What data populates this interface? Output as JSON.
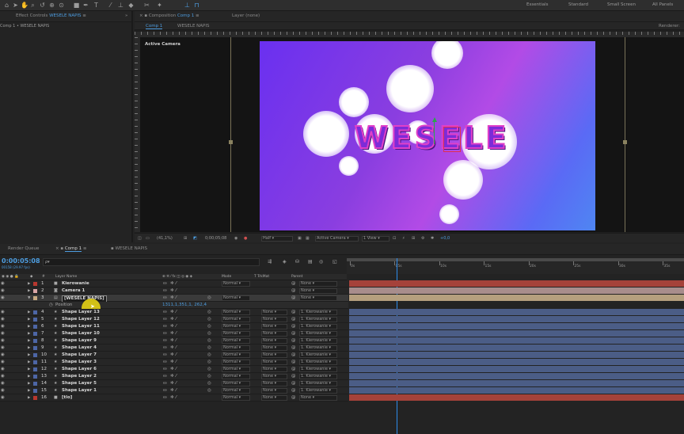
{
  "workspaces": [
    "Essentials",
    "Standard",
    "Small Screen",
    "All Panels"
  ],
  "left_panel": {
    "tab_label": "Effect Controls",
    "tab_layer": "WESELE NAPIS",
    "breadcrumb": "Comp 1 • WESELE NAPIS"
  },
  "comp_panel": {
    "tab_label": "Composition",
    "tab_comp": "Comp 1",
    "layer_tab": "Layer (none)",
    "nav_comp": "Comp 1",
    "nav_layer": "WESELE NAPIS",
    "renderer": "Renderer:",
    "active_camera": "Active Camera",
    "canvas_text": "WESELE",
    "zoom": "(41,1%)",
    "timecode": "0;00;05;08",
    "resolution": "Half",
    "view": "Active Camera",
    "views": "1 View",
    "exposure": "+0,0"
  },
  "bottom_tabs": {
    "render_queue": "Render Queue",
    "comp": "Comp 1",
    "layer": "WESELE NAPIS"
  },
  "timeline": {
    "current_time": "0:00:05:08",
    "frame_info": "00158 (29.97 fps)",
    "search_placeholder": "ρ▾",
    "columns": {
      "layer_name": "Layer Name",
      "mode": "Mode",
      "trkmat": "T TrkMat",
      "parent": "Parent"
    },
    "ruler_ticks": [
      "0s",
      "05s",
      "10s",
      "15s",
      "20s",
      "25s",
      "30s",
      "35s"
    ],
    "playhead_fraction": 0.149,
    "layers": [
      {
        "num": "1",
        "name": "Kierowanie",
        "color": "#b8372f",
        "icon": "null-box",
        "mode": "Normal",
        "trkmat": "",
        "parent": "None",
        "bar": "#a5423a"
      },
      {
        "num": "2",
        "name": "Camera 1",
        "color": "#d9a6a6",
        "icon": "camera-icon",
        "mode": "",
        "trkmat": "",
        "parent": "None",
        "bar": "#a88d8c"
      },
      {
        "num": "3",
        "name": "[WESELE NAPIS]",
        "color": "#c7a982",
        "icon": "precomp-icon",
        "mode": "Normal",
        "trkmat": "",
        "parent": "None",
        "bar": "#b59f7e"
      },
      {
        "num": "4",
        "name": "Shape Layer 13",
        "color": "#4d66a6",
        "icon": "star-icon",
        "mode": "Normal",
        "trkmat": "None",
        "parent": "1. Kierowanie",
        "bar": "#4b5d86"
      },
      {
        "num": "5",
        "name": "Shape Layer 12",
        "color": "#4d66a6",
        "icon": "star-icon",
        "mode": "Normal",
        "trkmat": "None",
        "parent": "1. Kierowanie",
        "bar": "#4b5d86"
      },
      {
        "num": "6",
        "name": "Shape Layer 11",
        "color": "#4d66a6",
        "icon": "star-icon",
        "mode": "Normal",
        "trkmat": "None",
        "parent": "1. Kierowanie",
        "bar": "#4b5d86"
      },
      {
        "num": "7",
        "name": "Shape Layer 10",
        "color": "#4d66a6",
        "icon": "star-icon",
        "mode": "Normal",
        "trkmat": "None",
        "parent": "1. Kierowanie",
        "bar": "#4b5d86"
      },
      {
        "num": "8",
        "name": "Shape Layer 9",
        "color": "#4d66a6",
        "icon": "star-icon",
        "mode": "Normal",
        "trkmat": "None",
        "parent": "1. Kierowanie",
        "bar": "#4b5d86"
      },
      {
        "num": "9",
        "name": "Shape Layer 4",
        "color": "#4d66a6",
        "icon": "star-icon",
        "mode": "Normal",
        "trkmat": "None",
        "parent": "1. Kierowanie",
        "bar": "#4b5d86"
      },
      {
        "num": "10",
        "name": "Shape Layer 7",
        "color": "#4d66a6",
        "icon": "star-icon",
        "mode": "Normal",
        "trkmat": "None",
        "parent": "1. Kierowanie",
        "bar": "#4b5d86"
      },
      {
        "num": "11",
        "name": "Shape Layer 3",
        "color": "#4d66a6",
        "icon": "star-icon",
        "mode": "Normal",
        "trkmat": "None",
        "parent": "1. Kierowanie",
        "bar": "#4b5d86"
      },
      {
        "num": "12",
        "name": "Shape Layer 6",
        "color": "#4d66a6",
        "icon": "star-icon",
        "mode": "Normal",
        "trkmat": "None",
        "parent": "1. Kierowanie",
        "bar": "#4b5d86"
      },
      {
        "num": "13",
        "name": "Shape Layer 2",
        "color": "#4d66a6",
        "icon": "star-icon",
        "mode": "Normal",
        "trkmat": "None",
        "parent": "1. Kierowanie",
        "bar": "#4b5d86"
      },
      {
        "num": "14",
        "name": "Shape Layer 5",
        "color": "#4d66a6",
        "icon": "star-icon",
        "mode": "Normal",
        "trkmat": "None",
        "parent": "1. Kierowanie",
        "bar": "#4b5d86"
      },
      {
        "num": "15",
        "name": "Shape Layer 1",
        "color": "#4d66a6",
        "icon": "star-icon",
        "mode": "Normal",
        "trkmat": "None",
        "parent": "1. Kierowanie",
        "bar": "#4b5d86"
      },
      {
        "num": "16",
        "name": "[tlo]",
        "color": "#b8372f",
        "icon": "solid-box",
        "mode": "Normal",
        "trkmat": "None",
        "parent": "None",
        "bar": "#a5423a"
      }
    ],
    "position_property": {
      "label": "Position",
      "value": "1311,1,351,1, 262,4"
    }
  }
}
